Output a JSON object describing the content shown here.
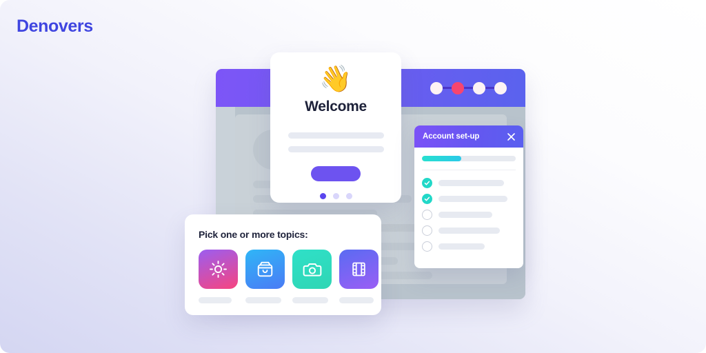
{
  "brand": {
    "name": "Denovers",
    "color": "#3f45e0"
  },
  "background_window": {
    "stepper": {
      "dots": [
        {
          "state": "inactive",
          "color": "#fdf3f4"
        },
        {
          "state": "active",
          "color": "#f7456f"
        },
        {
          "state": "inactive",
          "color": "#fdf3f4"
        },
        {
          "state": "inactive",
          "color": "#fdf3f4"
        }
      ]
    },
    "header_color": "#6a5df0",
    "placeholder_lines": [
      200,
      230,
      180,
      300,
      245,
      210,
      260
    ]
  },
  "welcome_card": {
    "emoji": "👋",
    "emoji_name": "waving-hand-emoji",
    "title": "Welcome",
    "placeholder_lines": [
      139,
      139
    ],
    "cta_label": "",
    "cta_color": "#6d53f0",
    "pagination": {
      "total": 3,
      "active_index": 0
    }
  },
  "setup_panel": {
    "title": "Account set-up",
    "close_icon": "close-icon",
    "progress": {
      "percent": 42,
      "fill_color": "#27e0cf",
      "track_color": "#e7eaf0"
    },
    "items": [
      {
        "checked": true,
        "label_width": 95
      },
      {
        "checked": true,
        "label_width": 100
      },
      {
        "checked": false,
        "label_width": 78
      },
      {
        "checked": false,
        "label_width": 89
      },
      {
        "checked": false,
        "label_width": 67
      }
    ],
    "check_color": "#22d8c8"
  },
  "topics_card": {
    "title": "Pick one or more topics:",
    "tiles": [
      {
        "icon": "sun-icon",
        "gradient_from": "#9b5ef0",
        "gradient_to": "#f7447f",
        "label_width": 48
      },
      {
        "icon": "shopping-bag-icon",
        "gradient_from": "#2fb6f7",
        "gradient_to": "#4a7bf5",
        "label_width": 52
      },
      {
        "icon": "camera-icon",
        "gradient_from": "#2fe0c8",
        "gradient_to": "#2fd6b4",
        "label_width": 52
      },
      {
        "icon": "film-icon",
        "gradient_from": "#5a6bf2",
        "gradient_to": "#9a5ef5",
        "label_width": 50
      }
    ]
  }
}
